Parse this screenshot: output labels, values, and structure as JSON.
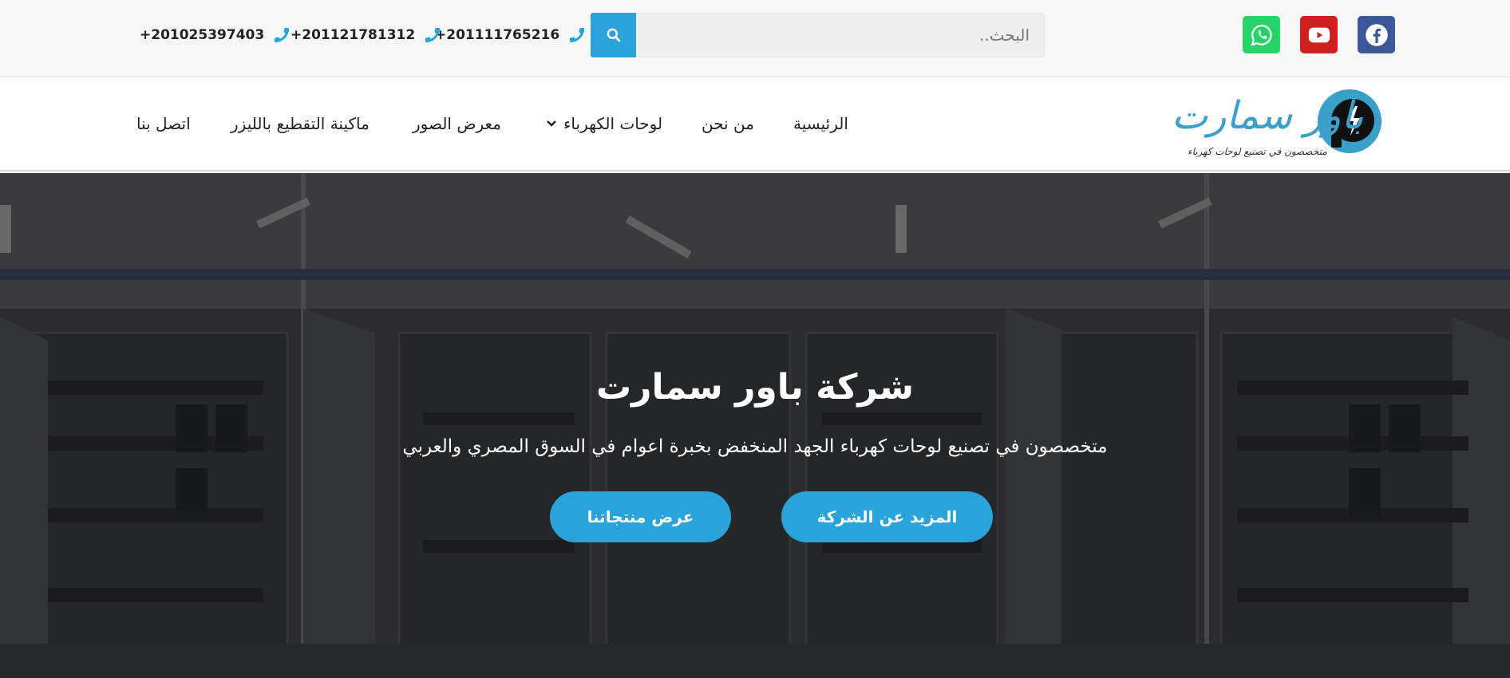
{
  "topbar": {
    "social": [
      {
        "name": "facebook",
        "icon": "facebook-icon",
        "color": "#3b5998"
      },
      {
        "name": "youtube",
        "icon": "youtube-icon",
        "color": "#cd201f"
      },
      {
        "name": "whatsapp",
        "icon": "whatsapp-icon",
        "color": "#25d366"
      }
    ],
    "search": {
      "placeholder": "البحث..",
      "value": "",
      "button_icon": "search-icon",
      "button_color": "#2aa3db"
    },
    "phones": [
      {
        "number": "+201111765216",
        "icon": "phone-icon"
      },
      {
        "number": "+201121781312",
        "icon": "phone-icon"
      },
      {
        "number": "+201025397403",
        "icon": "phone-icon"
      }
    ]
  },
  "logo": {
    "name": "باور سمارت",
    "tagline": "متخصصون في تصنيع لوحات كهرباء",
    "icon": "power-plug-logo-icon",
    "colors": {
      "ring": "#3a9fc9",
      "inner": "#111111"
    }
  },
  "nav": {
    "items": [
      {
        "label": "الرئيسية"
      },
      {
        "label": "من نحن"
      },
      {
        "label": "لوحات الكهرباء",
        "has_dropdown": true,
        "icon": "chevron-down-icon"
      },
      {
        "label": "معرض الصور"
      },
      {
        "label": "ماكينة التقطيع بالليزر"
      },
      {
        "label": "اتصل بنا"
      }
    ]
  },
  "hero": {
    "title": "شركة باور سمارت",
    "subtitle": "متخصصون في تصنيع لوحات كهرباء الجهد المنخفض بخبرة اعوام في السوق المصري والعربي",
    "buttons": {
      "company": "المزيد عن الشركة",
      "products": "عرض منتجاتنا"
    },
    "accent": "#2aa3db",
    "background": "electrical-panels-photo"
  }
}
